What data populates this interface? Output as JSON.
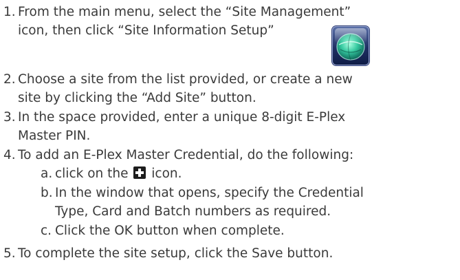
{
  "steps": [
    {
      "number": "1.",
      "lines": [
        "From the main menu, select the “Site Management”",
        "icon, then click “Site Information Setup”"
      ]
    },
    {
      "number": "2.",
      "lines": [
        "Choose a site from the list provided, or create a new",
        "site by clicking the “Add Site” button."
      ]
    },
    {
      "number": "3.",
      "lines": [
        "In the space provided, enter a unique 8-digit E-Plex",
        "Master PIN."
      ]
    },
    {
      "number": "4.",
      "lines": [
        "To add an E-Plex Master Credential, do the following:"
      ],
      "substeps": [
        {
          "letter": "a.",
          "before_icon": "click on the",
          "after_icon": "icon."
        },
        {
          "letter": "b.",
          "lines": [
            "In the window that opens, specify the Credential",
            "Type, Card and Batch numbers as required."
          ]
        },
        {
          "letter": "c.",
          "lines": [
            "Click the OK button when complete."
          ]
        }
      ]
    },
    {
      "number": "5.",
      "lines": [
        "To complete the site setup, click the Save button."
      ]
    }
  ],
  "icons": {
    "site_management": "site-management-globe-icon",
    "add": "plus-icon"
  },
  "colors": {
    "text": "#3a3a3a",
    "icon_bg": "#1f2f63",
    "globe": "#3fd0a0"
  }
}
